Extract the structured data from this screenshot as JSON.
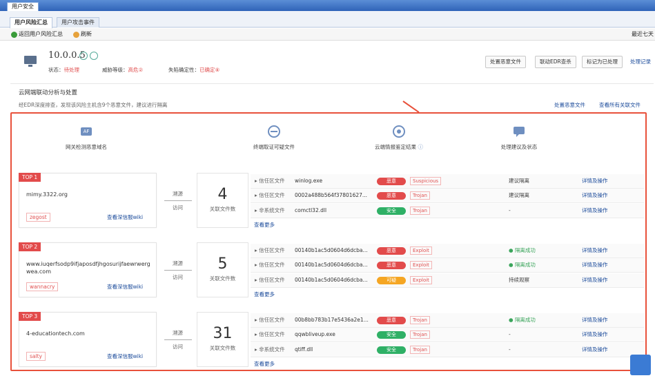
{
  "window": {
    "title": "用户安全"
  },
  "tabs": [
    {
      "label": "用户风险汇总",
      "active": true
    },
    {
      "label": "用户攻击事件",
      "active": false
    }
  ],
  "toolbar": {
    "back": "返回用户风险汇总",
    "refresh": "刷新",
    "right": "最近七天"
  },
  "host": {
    "ip": "10.0.0.5",
    "status_label": "状态：",
    "status": "待处理",
    "threat_label": "威胁等级：",
    "threat": "高危②",
    "certainty_label": "失陷确定性：",
    "certainty": "已确定⑧"
  },
  "actions": [
    "处置恶意文件",
    "联动EDR查杀",
    "标记为已处理",
    "处理记录"
  ],
  "section": {
    "title": "云网端联动分析与处置",
    "subtitle": "经EDR深度排查，发现该风险主机含9个恶意文件，建议进行隔离",
    "link1": "处置恶意文件",
    "link2": "查看所有关联文件"
  },
  "steps": [
    {
      "label": "网关检测恶意域名",
      "badge": "AF",
      "icon": "af-gateway-icon"
    },
    {
      "label": "终端取证可疑文件",
      "icon": "endpoint-wave-icon"
    },
    {
      "label": "云端情报鉴定结果",
      "icon": "cloud-target-icon"
    },
    {
      "label": "处理建议及状态",
      "icon": "chat-bubble-icon"
    }
  ],
  "info_icon": "ⓘ",
  "groups": [
    {
      "rank": "TOP 1",
      "domain": "mimy.3322.org",
      "family": "zegost",
      "wiki": "查看深信服wiki",
      "trace": "溯源",
      "visit": "访问",
      "count": "4",
      "count_label": "关联文件数",
      "more": "查看更多",
      "files": [
        {
          "type": "信任区文件",
          "name": "winlog.exe",
          "verdict": "恶意",
          "vclass": "mal",
          "tag": "Suspicious",
          "advice": "建议隔离",
          "advice_ok": false,
          "detail": "详情及操作"
        },
        {
          "type": "信任区文件",
          "name": "0002a488b564f37801627...",
          "verdict": "恶意",
          "vclass": "mal",
          "tag": "Trojan",
          "advice": "建议隔离",
          "advice_ok": false,
          "detail": "详情及操作"
        },
        {
          "type": "非系统文件",
          "name": "comctl32.dll",
          "verdict": "安全",
          "vclass": "safe",
          "tag": "Trojan",
          "advice": "-",
          "advice_ok": false,
          "detail": "详情及操作"
        }
      ]
    },
    {
      "rank": "TOP 2",
      "domain": "www.iuqerfsodp9ifjaposdfjhgosurijfaewrwergwea.com",
      "family": "wannacry",
      "wiki": "查看深信服wiki",
      "trace": "溯源",
      "visit": "访问",
      "count": "5",
      "count_label": "关联文件数",
      "more": "查看更多",
      "files": [
        {
          "type": "信任区文件",
          "name": "00140b1ac5d0604d6dcba...",
          "verdict": "恶意",
          "vclass": "mal",
          "tag": "Exploit",
          "advice": "隔离成功",
          "advice_ok": true,
          "detail": "详情及操作"
        },
        {
          "type": "信任区文件",
          "name": "00140b1ac5d0604d6dcba...",
          "verdict": "恶意",
          "vclass": "mal",
          "tag": "Exploit",
          "advice": "隔离成功",
          "advice_ok": true,
          "detail": "详情及操作"
        },
        {
          "type": "信任区文件",
          "name": "00140b1ac5d0604d6dcba...",
          "verdict": "可疑",
          "vclass": "sus",
          "tag": "Exploit",
          "advice": "持续观察",
          "advice_ok": false,
          "detail": "详情及操作"
        }
      ]
    },
    {
      "rank": "TOP 3",
      "domain": "4-educationtech.com",
      "family": "salty",
      "wiki": "查看深信服wiki",
      "trace": "溯源",
      "visit": "访问",
      "count": "31",
      "count_label": "关联文件数",
      "more": "查看更多",
      "files": [
        {
          "type": "信任区文件",
          "name": "00b8bb783b17e5436a2e1...",
          "verdict": "恶意",
          "vclass": "mal",
          "tag": "Trojan",
          "advice": "隔离成功",
          "advice_ok": true,
          "detail": "详情及操作"
        },
        {
          "type": "信任区文件",
          "name": "qqwbliveup.exe",
          "verdict": "安全",
          "vclass": "safe",
          "tag": "Trojan",
          "advice": "-",
          "advice_ok": false,
          "detail": "详情及操作"
        },
        {
          "type": "非系统文件",
          "name": "qtiff.dll",
          "verdict": "安全",
          "vclass": "safe",
          "tag": "Trojan",
          "advice": "-",
          "advice_ok": false,
          "detail": "详情及操作"
        }
      ]
    }
  ],
  "colors": {
    "mal": "#e24b4b",
    "safe": "#2fb066",
    "sus": "#f5a623",
    "accent": "#e8503a",
    "topbar": "#3a6fc4"
  }
}
